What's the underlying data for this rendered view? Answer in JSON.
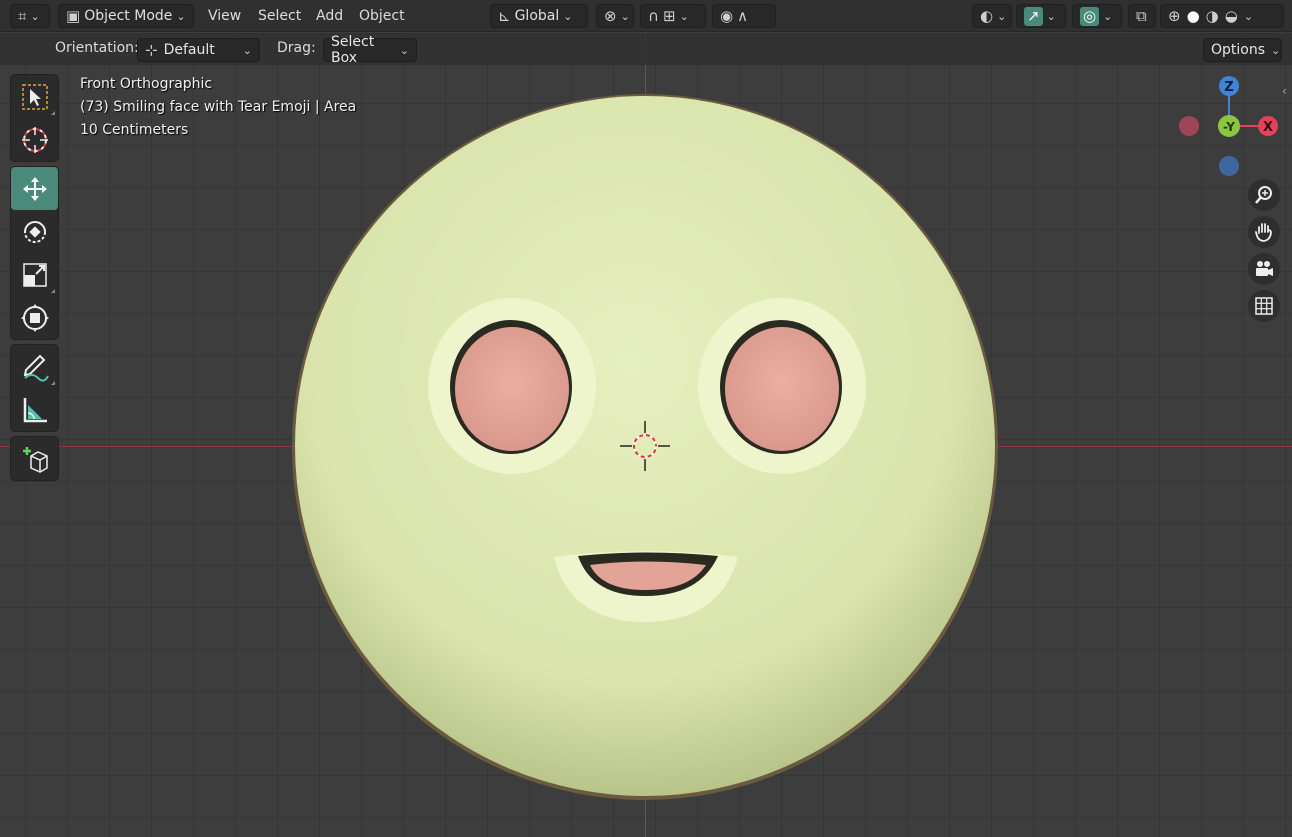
{
  "header": {
    "editor_type_icon": "axes-editor-icon",
    "mode": "Object Mode",
    "menus": [
      "View",
      "Select",
      "Add",
      "Object"
    ],
    "transform_orientation": "Global",
    "options_label": "Options"
  },
  "tool_settings": {
    "orientation_label": "Orientation:",
    "orientation_value": "Default",
    "drag_label": "Drag:",
    "drag_value": "Select Box"
  },
  "overlay": {
    "view_name": "Front Orthographic",
    "object_info": "(73) Smiling face with Tear Emoji | Area",
    "scale": "10 Centimeters"
  },
  "gizmo": {
    "z_label": "Z",
    "y_label": "-Y",
    "x_label": "X",
    "colors": {
      "x": "#e0435a",
      "y": "#8cc63f",
      "z": "#3f85d6"
    }
  },
  "toolbar_tools": [
    {
      "name": "select-box-tool"
    },
    {
      "name": "cursor-tool"
    },
    {
      "name": "move-tool",
      "active": true
    },
    {
      "name": "rotate-tool"
    },
    {
      "name": "scale-tool"
    },
    {
      "name": "transform-tool"
    },
    {
      "name": "annotate-tool"
    },
    {
      "name": "measure-tool"
    },
    {
      "name": "add-cube-tool"
    }
  ],
  "colors": {
    "accent": "#4a8a7a",
    "face": "#dfe8b6",
    "eye": "#e7a89a",
    "viewport_bg": "#3d3d3d"
  }
}
